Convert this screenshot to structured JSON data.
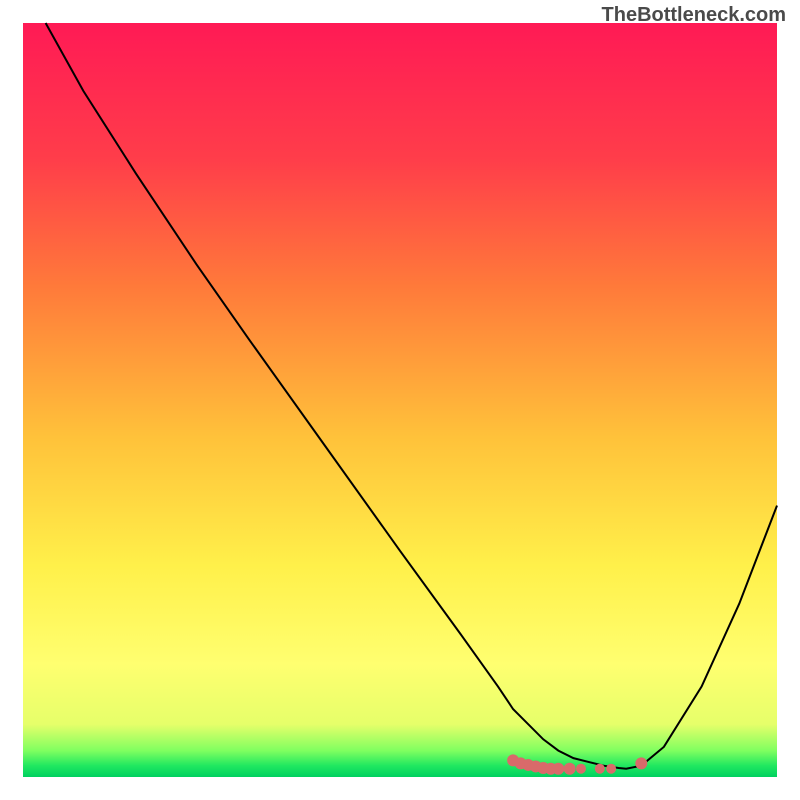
{
  "watermark": "TheBottleneck.com",
  "chart_data": {
    "type": "line",
    "title": "",
    "xlabel": "",
    "ylabel": "",
    "xlim": [
      0,
      100
    ],
    "ylim": [
      0,
      100
    ],
    "series": [
      {
        "name": "curve",
        "color": "#000000",
        "x": [
          3,
          8,
          15,
          23,
          30,
          40,
          50,
          58,
          63,
          65,
          67,
          69,
          71,
          73,
          75,
          77,
          79,
          80,
          82,
          85,
          90,
          95,
          100
        ],
        "y": [
          100,
          91,
          80,
          68,
          58,
          44,
          30,
          19,
          12,
          9,
          7,
          5,
          3.5,
          2.5,
          2,
          1.5,
          1.2,
          1.1,
          1.5,
          4,
          12,
          23,
          36
        ]
      }
    ],
    "markers": [
      {
        "x": 65,
        "y": 2.2,
        "color": "#d96a6a",
        "size": 6
      },
      {
        "x": 66,
        "y": 1.8,
        "color": "#d96a6a",
        "size": 6
      },
      {
        "x": 67,
        "y": 1.6,
        "color": "#d96a6a",
        "size": 6
      },
      {
        "x": 68,
        "y": 1.4,
        "color": "#d96a6a",
        "size": 6
      },
      {
        "x": 69,
        "y": 1.2,
        "color": "#d96a6a",
        "size": 6
      },
      {
        "x": 70,
        "y": 1.1,
        "color": "#d96a6a",
        "size": 6
      },
      {
        "x": 71,
        "y": 1.1,
        "color": "#d96a6a",
        "size": 6
      },
      {
        "x": 72.5,
        "y": 1.1,
        "color": "#d96a6a",
        "size": 6
      },
      {
        "x": 74,
        "y": 1.1,
        "color": "#d96a6a",
        "size": 5
      },
      {
        "x": 76.5,
        "y": 1.1,
        "color": "#d96a6a",
        "size": 5
      },
      {
        "x": 78,
        "y": 1.1,
        "color": "#d96a6a",
        "size": 5
      },
      {
        "x": 82,
        "y": 1.8,
        "color": "#d96a6a",
        "size": 6
      }
    ],
    "gradient_stops": [
      {
        "offset": 0,
        "color": "#ff1a55"
      },
      {
        "offset": 18,
        "color": "#ff3d4a"
      },
      {
        "offset": 35,
        "color": "#ff7a3a"
      },
      {
        "offset": 55,
        "color": "#ffc23a"
      },
      {
        "offset": 72,
        "color": "#fff04a"
      },
      {
        "offset": 85,
        "color": "#ffff70"
      },
      {
        "offset": 93,
        "color": "#e6ff6a"
      },
      {
        "offset": 96.5,
        "color": "#80ff60"
      },
      {
        "offset": 98.5,
        "color": "#20e860"
      },
      {
        "offset": 100,
        "color": "#00d060"
      }
    ]
  }
}
